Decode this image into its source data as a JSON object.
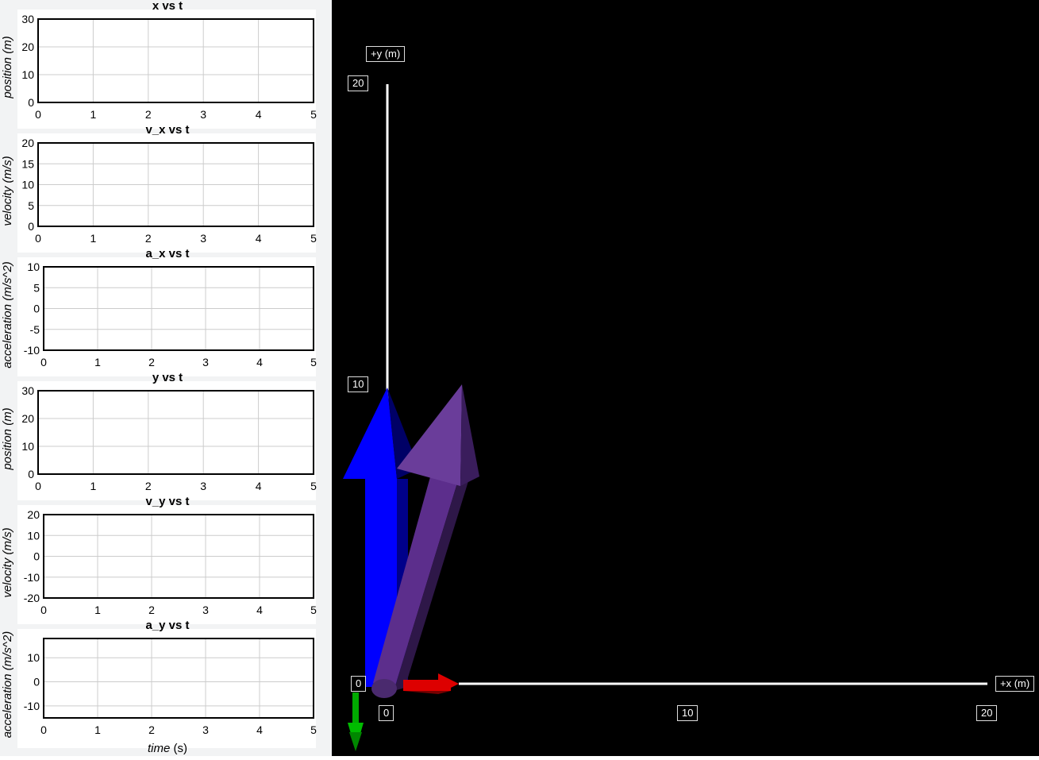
{
  "charts_panel": {
    "charts": [
      {
        "title": "x vs t",
        "ylabel": "position (m)",
        "yticks": [
          "30",
          "20",
          "10",
          "0"
        ],
        "xticks": [
          "0",
          "1",
          "2",
          "3",
          "4",
          "5"
        ]
      },
      {
        "title": "v_x vs t",
        "ylabel": "velocity (m/s)",
        "yticks": [
          "20",
          "15",
          "10",
          "5",
          "0"
        ],
        "xticks": [
          "0",
          "1",
          "2",
          "3",
          "4",
          "5"
        ]
      },
      {
        "title": "a_x vs t",
        "ylabel": "acceleration (m/s^2)",
        "yticks": [
          "10",
          "5",
          "0",
          "-5",
          "-10"
        ],
        "xticks": [
          "0",
          "1",
          "2",
          "3",
          "4",
          "5"
        ]
      },
      {
        "title": "y vs t",
        "ylabel": "position (m)",
        "yticks": [
          "30",
          "20",
          "10",
          "0"
        ],
        "xticks": [
          "0",
          "1",
          "2",
          "3",
          "4",
          "5"
        ]
      },
      {
        "title": "v_y vs t",
        "ylabel": "velocity (m/s)",
        "yticks": [
          "20",
          "10",
          "0",
          "-10",
          "-20"
        ],
        "xticks": [
          "0",
          "1",
          "2",
          "3",
          "4",
          "5"
        ]
      },
      {
        "title": "a_y vs t",
        "ylabel": "acceleration (m/s^2)",
        "yticks": [
          "10",
          "0",
          "-10"
        ],
        "xticks": [
          "0",
          "1",
          "2",
          "3",
          "4",
          "5"
        ]
      }
    ],
    "xlabel_italic": "time",
    "xlabel_unit": " (s)"
  },
  "chart_data": [
    {
      "type": "line",
      "title": "x vs t",
      "xlabel": "",
      "ylabel": "position (m)",
      "xlim": [
        0,
        5
      ],
      "ylim": [
        0,
        30
      ],
      "grid": true,
      "series": []
    },
    {
      "type": "line",
      "title": "v_x vs t",
      "xlabel": "",
      "ylabel": "velocity (m/s)",
      "xlim": [
        0,
        5
      ],
      "ylim": [
        0,
        20
      ],
      "grid": true,
      "series": []
    },
    {
      "type": "line",
      "title": "a_x vs t",
      "xlabel": "",
      "ylabel": "acceleration (m/s^2)",
      "xlim": [
        0,
        5
      ],
      "ylim": [
        -10,
        10
      ],
      "grid": true,
      "series": []
    },
    {
      "type": "line",
      "title": "y vs t",
      "xlabel": "",
      "ylabel": "position (m)",
      "xlim": [
        0,
        5
      ],
      "ylim": [
        0,
        30
      ],
      "grid": true,
      "series": []
    },
    {
      "type": "line",
      "title": "v_y vs t",
      "xlabel": "",
      "ylabel": "velocity (m/s)",
      "xlim": [
        0,
        5
      ],
      "ylim": [
        -20,
        20
      ],
      "grid": true,
      "series": []
    },
    {
      "type": "line",
      "title": "a_y vs t",
      "xlabel": "time (s)",
      "ylabel": "acceleration (m/s^2)",
      "xlim": [
        0,
        5
      ],
      "ylim": [
        -15,
        18
      ],
      "grid": true,
      "series": []
    }
  ],
  "scene": {
    "x_axis_label": "+x (m)",
    "y_axis_label": "+y (m)",
    "x_ticks": [
      "0",
      "10",
      "20"
    ],
    "y_ticks": [
      "20",
      "10",
      "0"
    ],
    "colors": {
      "background": "#000000",
      "axis": "#ffffff",
      "y_arrow": "#0000ff",
      "resultant_arrow": "#6a3d9a",
      "x_arrow": "#dd0000",
      "accel_arrow": "#00bb00"
    }
  }
}
